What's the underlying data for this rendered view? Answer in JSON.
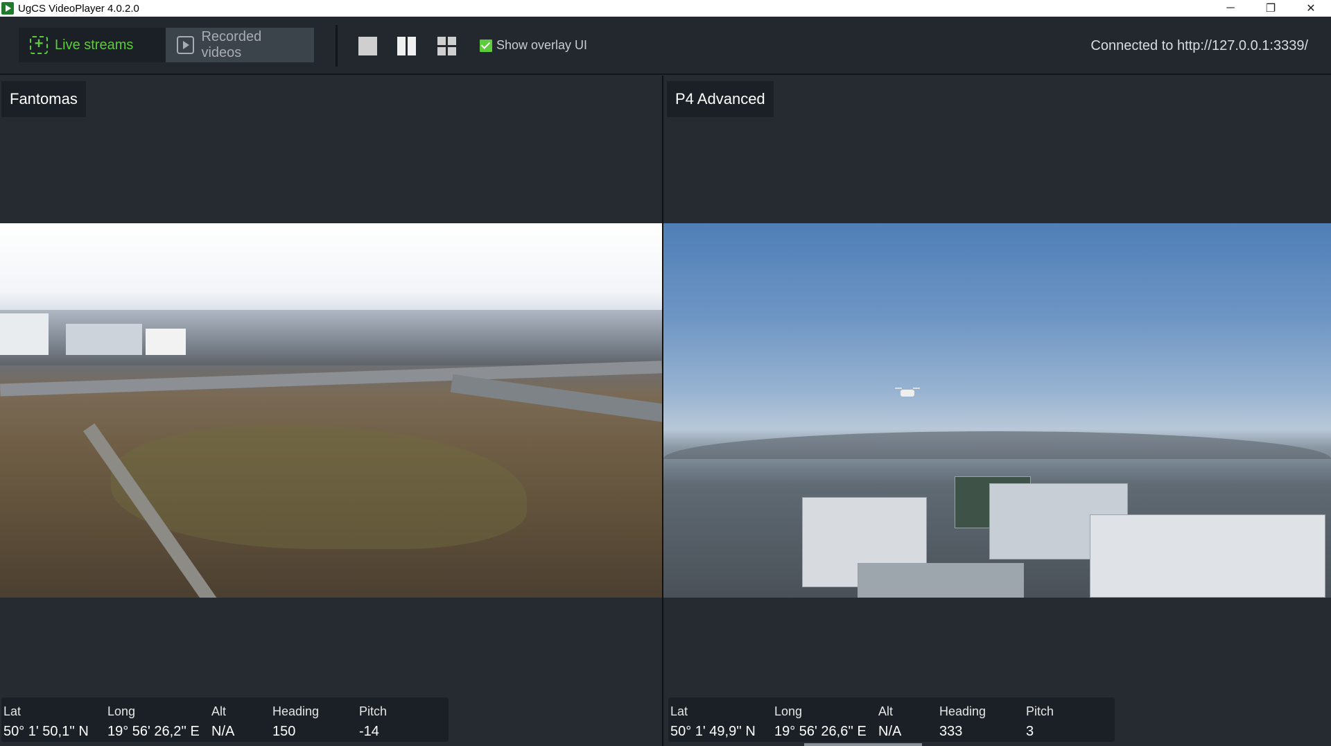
{
  "window": {
    "title": "UgCS VideoPlayer 4.0.2.0",
    "controls": {
      "minimize": "─",
      "maximize": "❐",
      "close": "✕"
    }
  },
  "toolbar": {
    "tabs": [
      {
        "label": "Live streams",
        "active": true
      },
      {
        "label": "Recorded videos",
        "active": false
      }
    ],
    "layout_buttons": [
      "single-view",
      "two-column-view",
      "grid-view"
    ],
    "overlay_toggle": {
      "label": "Show overlay UI",
      "checked": true
    },
    "connection_status": "Connected to http://127.0.0.1:3339/"
  },
  "colors": {
    "accent": "#5ccc3a",
    "background": "#252b31",
    "toolbar": "#22282e",
    "panel_label_bg": "#1b2026"
  },
  "panels": [
    {
      "title": "Fantomas",
      "telemetry": {
        "labels": [
          "Lat",
          "Long",
          "Alt",
          "Heading",
          "Pitch"
        ],
        "values": [
          "50° 1' 50,1'' N",
          "19° 56' 26,2'' E",
          "N/A",
          "150",
          "-14"
        ]
      }
    },
    {
      "title": "P4 Advanced",
      "telemetry": {
        "labels": [
          "Lat",
          "Long",
          "Alt",
          "Heading",
          "Pitch"
        ],
        "values": [
          "50° 1' 49,9'' N",
          "19° 56' 26,6'' E",
          "N/A",
          "333",
          "3"
        ]
      }
    }
  ]
}
